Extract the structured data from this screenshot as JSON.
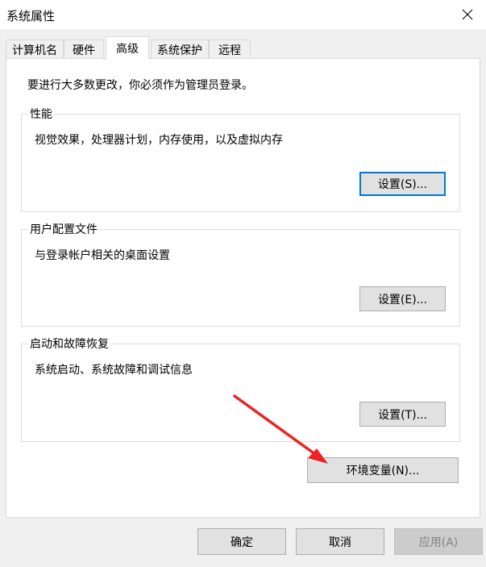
{
  "window": {
    "title": "系统属性"
  },
  "tabs": [
    {
      "label": "计算机名",
      "active": false
    },
    {
      "label": "硬件",
      "active": false
    },
    {
      "label": "高级",
      "active": true
    },
    {
      "label": "系统保护",
      "active": false
    },
    {
      "label": "远程",
      "active": false
    }
  ],
  "advanced": {
    "admin_note": "要进行大多数更改，你必须作为管理员登录。",
    "performance": {
      "title": "性能",
      "description": "视觉效果，处理器计划，内存使用，以及虚拟内存",
      "button": "设置(S)..."
    },
    "user_profiles": {
      "title": "用户配置文件",
      "description": "与登录帐户相关的桌面设置",
      "button": "设置(E)..."
    },
    "startup_recovery": {
      "title": "启动和故障恢复",
      "description": "系统启动、系统故障和调试信息",
      "button": "设置(T)..."
    },
    "env_button": "环境变量(N)..."
  },
  "footer": {
    "ok": "确定",
    "cancel": "取消",
    "apply": "应用(A)"
  },
  "colors": {
    "annotation_arrow": "#ee2222",
    "focus": "#0078d7"
  }
}
